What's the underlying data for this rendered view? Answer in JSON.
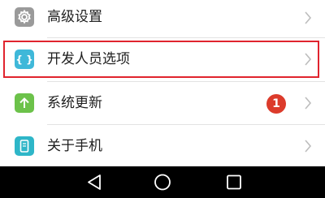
{
  "settings": {
    "items": [
      {
        "label": "高级设置",
        "icon": "gear-icon",
        "icon_color": "#9a9a9a"
      },
      {
        "label": "开发人员选项",
        "icon": "braces-icon",
        "icon_color": "#3fb8d9"
      },
      {
        "label": "系统更新",
        "icon": "arrow-up-icon",
        "icon_color": "#6cc24a",
        "badge": "1"
      },
      {
        "label": "关于手机",
        "icon": "phone-info-icon",
        "icon_color": "#2eb6c8"
      }
    ],
    "highlighted_item": "开发人员选项",
    "highlight_color": "#e0242e",
    "badge_color": "#dc3b2b"
  },
  "navbar": {
    "buttons": [
      "back-icon",
      "home-icon",
      "recent-apps-icon"
    ]
  }
}
